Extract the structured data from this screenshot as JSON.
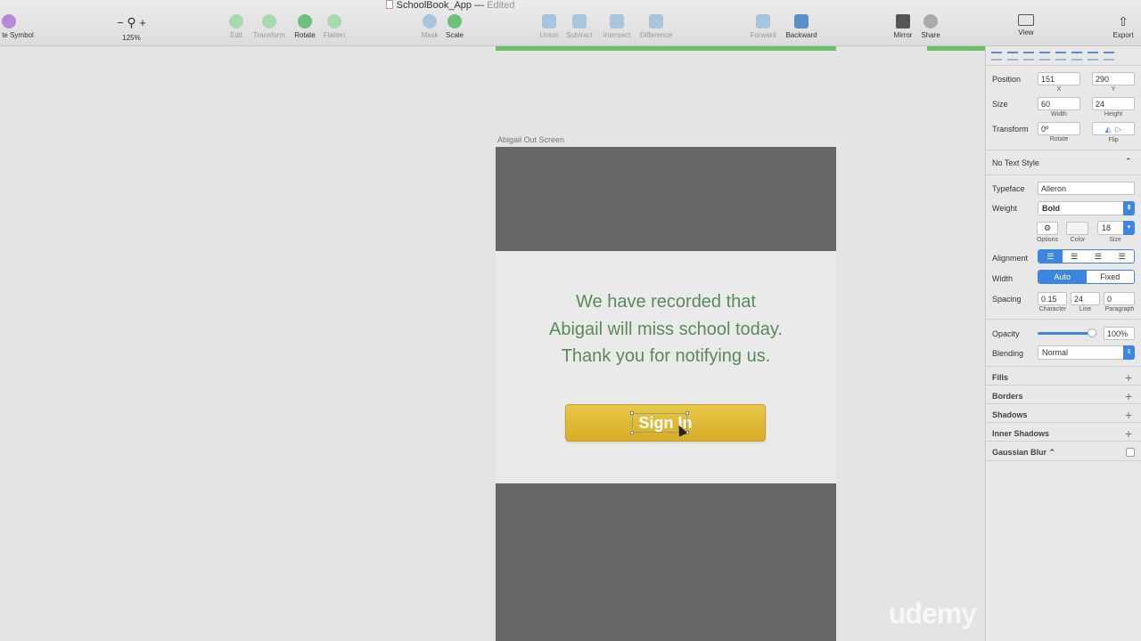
{
  "window": {
    "title": "SchoolBook_App",
    "status": "Edited"
  },
  "toolbar": {
    "symbol_label": "te Symbol",
    "zoom_minus": "−",
    "zoom_plus": "+",
    "zoom_value": "125%",
    "edit": "Edit",
    "transform": "Transform",
    "rotate": "Rotate",
    "flatten": "Flatten",
    "mask": "Mask",
    "scale": "Scale",
    "union": "Union",
    "subtract": "Subtract",
    "intersect": "Intersect",
    "difference": "Difference",
    "forward": "Forward",
    "backward": "Backward",
    "mirror": "Mirror",
    "share": "Share",
    "view": "View",
    "export": "Export"
  },
  "canvas": {
    "artboard_name": "Abigail Out Screen",
    "message_line1": "We have recorded that",
    "message_line2": "Abigail will miss school today.",
    "message_line3": "Thank you for notifying us.",
    "button_label": "Sign In",
    "watermark": "udemy"
  },
  "inspector": {
    "position_label": "Position",
    "position_x": "151",
    "position_y": "290",
    "x_label": "X",
    "y_label": "Y",
    "size_label": "Size",
    "width": "60",
    "height": "24",
    "width_label": "Width",
    "height_label": "Height",
    "transform_label": "Transform",
    "rotate_value": "0º",
    "rotate_label": "Rotate",
    "flip_label": "Flip",
    "text_style": "No Text Style",
    "typeface_label": "Typeface",
    "typeface": "Alleron",
    "weight_label": "Weight",
    "weight": "Bold",
    "options_label": "Options",
    "color_label": "Color",
    "size_sub_label": "Size",
    "font_size": "18",
    "alignment_label": "Alignment",
    "width_mode_label": "Width",
    "width_auto": "Auto",
    "width_fixed": "Fixed",
    "spacing_label": "Spacing",
    "character": "0.15",
    "line": "24",
    "paragraph": "0",
    "character_label": "Character",
    "line_label": "Line",
    "paragraph_label": "Paragraph",
    "opacity_label": "Opacity",
    "opacity": "100%",
    "blending_label": "Blending",
    "blending": "Normal",
    "fills": "Fills",
    "borders": "Borders",
    "shadows": "Shadows",
    "inner_shadows": "Inner Shadows",
    "gaussian_blur": "Gaussian Blur ⌃"
  },
  "colors": {
    "accent": "#3d86e0",
    "button_gold": "#dcb633",
    "message_green": "#5a8a5a",
    "artboard_gray": "#666666"
  }
}
